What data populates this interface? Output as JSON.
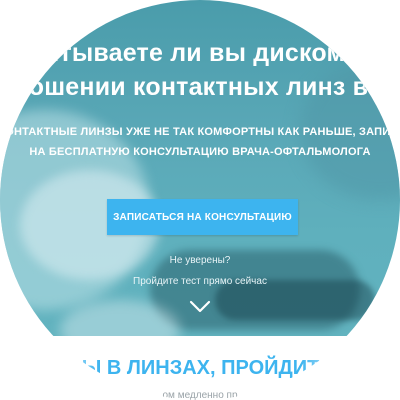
{
  "hero": {
    "headline_line1": "Испытываете ли вы дискомфорт",
    "headline_line2": "при ношении контактных линз в конце дня?",
    "subline_line1": "Ваши контактные линзы уже не так комфортны как раньше, запишитесь",
    "subline_line2": "на бесплатную консультацию врача-офтальмолога",
    "cta_label": "Записаться на консультацию",
    "unsure_text": "Не уверены?",
    "test_link": "Пройдите тест прямо сейчас",
    "scroll_icon": "chevron-down-icon"
  },
  "section": {
    "heading": "Вы в линзах, пройдите",
    "text": "ом медленно пр"
  },
  "colors": {
    "accent": "#3db4ef",
    "hero_overlay": "#5aa8b7",
    "heading_blue": "#3db4ef",
    "muted_text": "#9aa3a8"
  }
}
